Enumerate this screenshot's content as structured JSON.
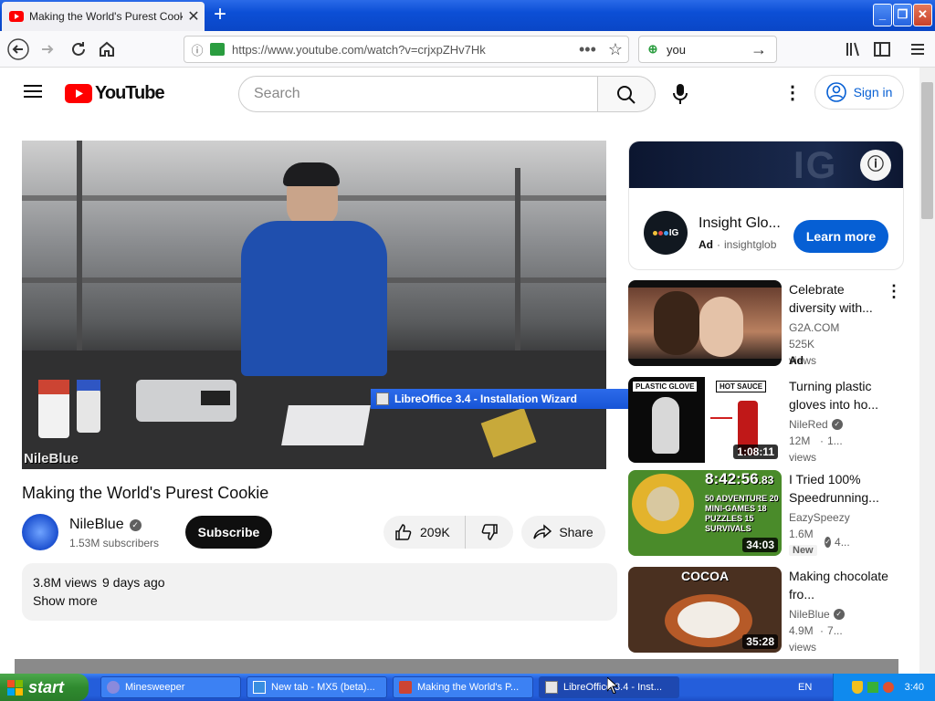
{
  "browser": {
    "tab_title": "Making the World's Purest Cookie",
    "url": "https://www.youtube.com/watch?v=crjxpZHv7Hk",
    "search_value": "you"
  },
  "youtube": {
    "logo_text": "YouTube",
    "search_placeholder": "Search",
    "signin_label": "Sign in"
  },
  "video": {
    "watermark": "NileBlue",
    "title": "Making the World's Purest Cookie",
    "channel": "NileBlue",
    "subscribers": "1.53M subscribers",
    "subscribe_label": "Subscribe",
    "likes": "209K",
    "share_label": "Share",
    "views": "3.8M views",
    "age": "9 days ago",
    "show_more": "Show more"
  },
  "overlay": {
    "libreoffice_title": "LibreOffice 3.4 - Installation Wizard"
  },
  "ad": {
    "banner_text": "IG",
    "advertiser": "Insight Glo...",
    "ad_label": "Ad",
    "domain": "insightglob",
    "cta": "Learn more",
    "logo_text": "IG"
  },
  "recommendations": [
    {
      "title": "Celebrate diversity with...",
      "channel": "G2A.COM",
      "views": "525K views",
      "extra": "Ad",
      "duration": ""
    },
    {
      "title": "Turning plastic gloves into ho...",
      "channel": "NileRed",
      "views": "12M views",
      "extra": "1...",
      "duration": "1:08:11",
      "thumb_label_left": "PLASTIC GLOVE",
      "thumb_label_right": "HOT SAUCE"
    },
    {
      "title": "I Tried 100% Speedrunning...",
      "channel": "EazySpeezy",
      "views": "1.6M views",
      "extra": "4...",
      "duration": "34:03",
      "badge": "New",
      "thumb_timer": "8:42:56",
      "thumb_timer_ms": ".83",
      "thumb_text": "50 ADVENTURE 20 MINI-GAMES 18 PUZZLES 15 SURVIVALS"
    },
    {
      "title": "Making chocolate fro...",
      "channel": "NileBlue",
      "views": "4.9M views",
      "extra": "7...",
      "duration": "35:28",
      "thumb_label": "COCOA"
    }
  ],
  "taskbar": {
    "start_label": "start",
    "items": [
      "Minesweeper",
      "New tab - MX5 (beta)...",
      "Making the World's P...",
      "LibreOffice 3.4 - Inst..."
    ],
    "lang": "EN",
    "clock": "3:40"
  },
  "colors": {
    "yt_red": "#ff0000",
    "link_blue": "#065fd4",
    "xp_blue": "#245edb",
    "xp_green": "#2f8a2f"
  }
}
